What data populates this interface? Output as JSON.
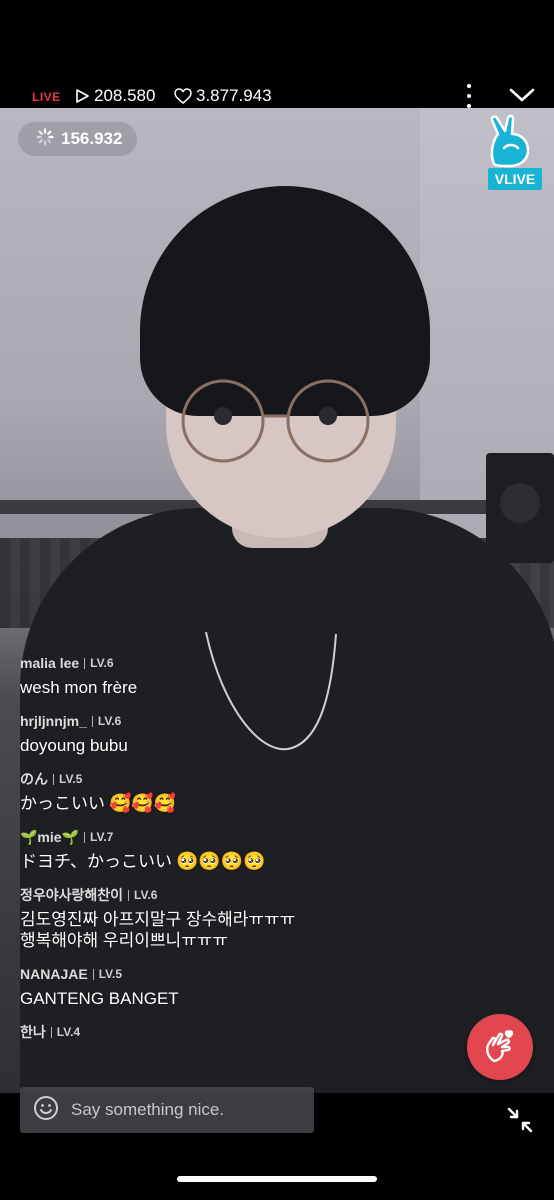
{
  "status": {
    "live_label": "LIVE",
    "views": "208.580",
    "likes": "3.877.943",
    "icons": [
      "play-icon",
      "heart-outline-icon",
      "more-vertical-icon",
      "chevron-down-icon"
    ]
  },
  "overlay": {
    "viewers": "156.932",
    "brand": "VLIVE",
    "accent": "#18b4d6"
  },
  "chat": [
    {
      "user": "malia lee",
      "level": "LV.6",
      "text": "wesh mon frère",
      "emoji": ""
    },
    {
      "user": "hrjljnnjm_",
      "level": "LV.6",
      "text": "doyoung bubu",
      "emoji": ""
    },
    {
      "user": "のん",
      "level": "LV.5",
      "text": "かっこいい",
      "emoji": "🥰🥰🥰"
    },
    {
      "user": "🌱mie🌱",
      "level": "LV.7",
      "text": "ドヨチ、かっこいい",
      "emoji": "🥺🥺🥺🥺"
    },
    {
      "user": "정우야사랑해찬이",
      "level": "LV.6",
      "text": "김도영진짜 아프지말구 장수해라ㅠㅠㅠ",
      "text2": "행복해야해 우리이쁘니ㅠㅠㅠ",
      "emoji": ""
    },
    {
      "user": "NANAJAE",
      "level": "LV.5",
      "text": "GANTENG BANGET",
      "emoji": ""
    },
    {
      "user": "한나",
      "level": "LV.4",
      "text": "",
      "emoji": ""
    }
  ],
  "composer": {
    "placeholder": "Say something nice."
  },
  "colors": {
    "live": "#e8334a",
    "heart_button": "#e2464f"
  }
}
